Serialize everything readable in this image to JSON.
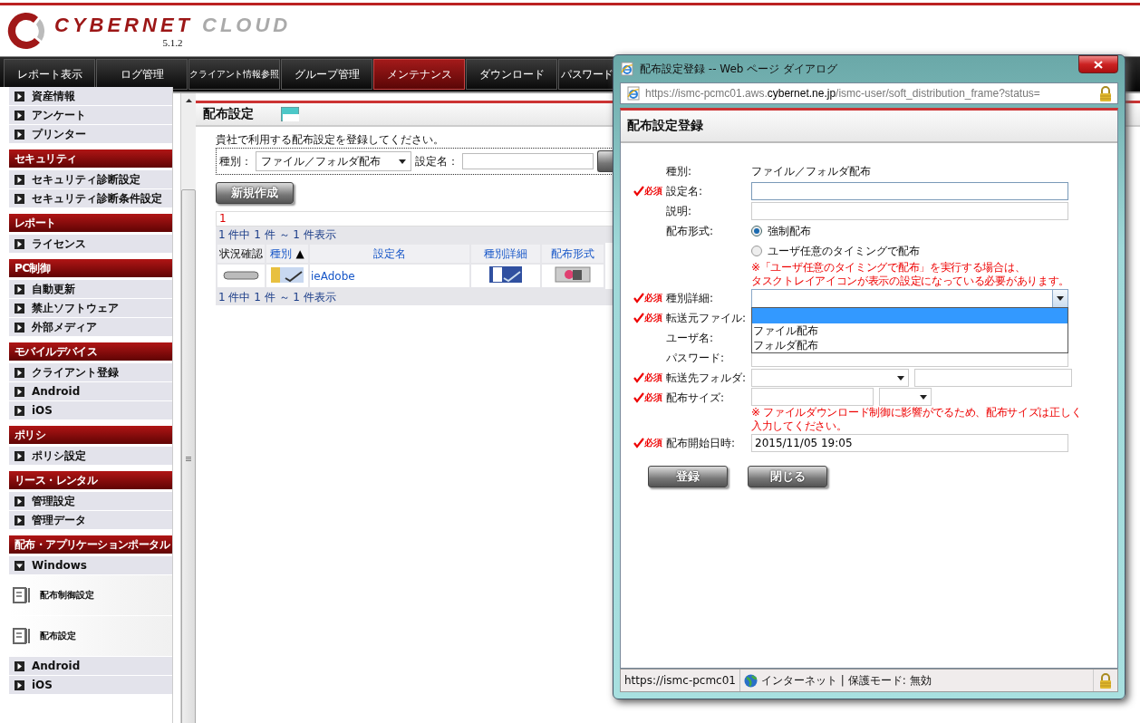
{
  "logo": {
    "name_primary": "CYBERNET",
    "name_secondary": "CLOUD",
    "version": "5.1.2"
  },
  "nav": [
    {
      "label": "レポート表示",
      "selected": false
    },
    {
      "label": "ログ管理",
      "selected": false
    },
    {
      "label": "クライアント情報参照",
      "selected": false
    },
    {
      "label": "グループ管理",
      "selected": false
    },
    {
      "label": "メンテナンス",
      "selected": true
    },
    {
      "label": "ダウンロード",
      "selected": false
    },
    {
      "label": "パスワード",
      "selected": false
    }
  ],
  "sidebar": {
    "sections": [
      {
        "items": [
          {
            "label": "資産情報",
            "kind": "item",
            "expanded": false
          },
          {
            "label": "アンケート",
            "kind": "item",
            "expanded": false
          },
          {
            "label": "プリンター",
            "kind": "item",
            "expanded": false
          }
        ]
      },
      {
        "title": "セキュリティ",
        "items": [
          {
            "label": "セキュリティ診断設定",
            "kind": "item",
            "expanded": false
          },
          {
            "label": "セキュリティ診断条件設定",
            "kind": "item",
            "expanded": false
          }
        ]
      },
      {
        "title": "レポート",
        "items": [
          {
            "label": "ライセンス",
            "kind": "item",
            "expanded": false
          }
        ]
      },
      {
        "title": "PC制御",
        "items": [
          {
            "label": "自動更新",
            "kind": "item",
            "expanded": false
          },
          {
            "label": "禁止ソフトウェア",
            "kind": "item",
            "expanded": false
          },
          {
            "label": "外部メディア",
            "kind": "item",
            "expanded": false
          }
        ]
      },
      {
        "title": "モバイルデバイス",
        "items": [
          {
            "label": "クライアント登録",
            "kind": "item",
            "expanded": false
          },
          {
            "label": "Android",
            "kind": "item",
            "expanded": false
          },
          {
            "label": "iOS",
            "kind": "item",
            "expanded": false
          }
        ]
      },
      {
        "title": "ポリシ",
        "items": [
          {
            "label": "ポリシ設定",
            "kind": "item",
            "expanded": false
          }
        ]
      },
      {
        "title": "リース・レンタル",
        "items": [
          {
            "label": "管理設定",
            "kind": "item",
            "expanded": false
          },
          {
            "label": "管理データ",
            "kind": "item",
            "expanded": false
          }
        ]
      },
      {
        "title": "配布・アプリケーションポータル",
        "items": [
          {
            "label": "Windows",
            "kind": "item",
            "expanded": true
          },
          {
            "label": "配布制御設定",
            "kind": "sub"
          },
          {
            "label": "配布設定",
            "kind": "sub"
          },
          {
            "label": "Android",
            "kind": "item",
            "expanded": false
          },
          {
            "label": "iOS",
            "kind": "item",
            "expanded": false
          }
        ]
      }
    ]
  },
  "main": {
    "title": "配布設定",
    "description": "貴社で利用する配布設定を登録してください。",
    "filter": {
      "type_label": "種別：",
      "type_value": "ファイル／フォルダ配布",
      "name_label": "設定名："
    },
    "new_button": "新規作成",
    "page": "1",
    "count_top": "1 件中 1 件 ～ 1 件表示",
    "count_bottom": "1 件中 1 件 ～ 1 件表示",
    "table": {
      "columns": [
        {
          "label": "状況確認",
          "link": false
        },
        {
          "label": "種別",
          "link": true,
          "sort_mark": "▲"
        },
        {
          "label": "設定名",
          "link": true
        },
        {
          "label": "種別詳細",
          "link": true
        },
        {
          "label": "配布形式",
          "link": true
        }
      ],
      "rows": [
        {
          "cells": [
            {
              "kind": "status"
            },
            {
              "kind": "folder"
            },
            {
              "kind": "link",
              "text": "ieAdobe"
            },
            {
              "kind": "file"
            },
            {
              "kind": "install"
            }
          ]
        }
      ]
    }
  },
  "dialog": {
    "title": "配布設定登録 -- Web ページ ダイアログ",
    "address": {
      "scheme": "https://",
      "host_prefix": "ismc-pcmc01.aws.",
      "domain": "cybernet.ne.jp",
      "path": "/ismc-user/soft_distribution_frame?status="
    },
    "heading": "配布設定登録",
    "fields": [
      {
        "label": "種別:",
        "kind": "text",
        "value": "ファイル／フォルダ配布"
      },
      {
        "label": "設定名:",
        "required_mark": "必須",
        "kind": "input",
        "focused": true
      },
      {
        "label": "説明:",
        "kind": "input",
        "focused": false
      },
      {
        "label": "配布形式:",
        "kind": "radio",
        "options": [
          {
            "label": "強制配布",
            "selected": true
          },
          {
            "label": "ユーザ任意のタイミングで配布",
            "selected": false
          }
        ],
        "note_lines": [
          "※「ユーザ任意のタイミングで配布」を実行する場合は、",
          "タスクトレイアイコンが表示の設定になっている必要があります。"
        ]
      },
      {
        "label": "種別詳細:",
        "required_mark": "必須",
        "kind": "select",
        "expanded": true,
        "options": [
          {
            "label": "ファイル配布"
          },
          {
            "label": "フォルダ配布"
          }
        ]
      },
      {
        "label": "転送元ファイル:",
        "required_mark": "必須",
        "kind": "blank"
      },
      {
        "label": "ユーザ名:",
        "kind": "blank"
      },
      {
        "label": "パスワード:",
        "kind": "input",
        "focused": false
      },
      {
        "label": "転送先フォルダ:",
        "required_mark": "必須",
        "kind": "select_input"
      },
      {
        "label": "配布サイズ:",
        "required_mark": "必須",
        "kind": "input_select",
        "note_lines": [
          "※ ファイルダウンロード制御に影響がでるため、配布サイズは正しく",
          "入力してください。"
        ]
      },
      {
        "label": "配布開始日時:",
        "required_mark": "必須",
        "kind": "input",
        "focused": false,
        "value": "2015/11/05 19:05"
      }
    ],
    "buttons": [
      "登録",
      "閉じる"
    ],
    "status": {
      "url": "https://ismc-pcmc01",
      "zone": "インターネット | 保護モード: 無効"
    }
  }
}
